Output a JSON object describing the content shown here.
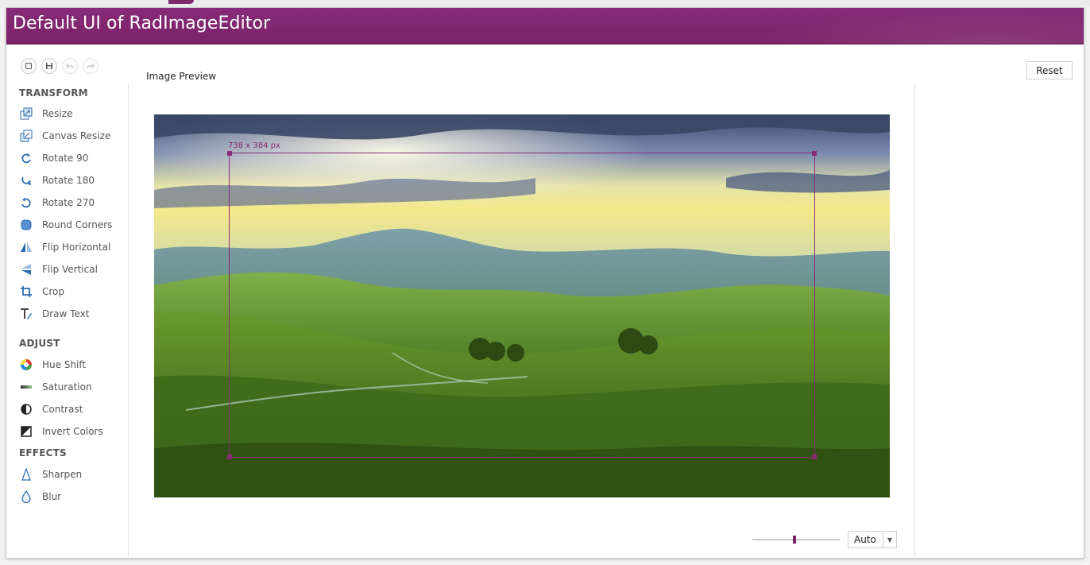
{
  "app": {
    "title": "Default UI of RadImageEditor"
  },
  "toolbar": {
    "buttons": [
      {
        "icon": "open-icon"
      },
      {
        "icon": "save-icon"
      },
      {
        "icon": "undo-icon"
      },
      {
        "icon": "redo-icon"
      }
    ]
  },
  "sidebar": {
    "transform_title": "TRANSFORM",
    "transform": [
      {
        "label": "Resize",
        "icon": "resize-icon"
      },
      {
        "label": "Canvas Resize",
        "icon": "canvas-resize-icon"
      },
      {
        "label": "Rotate 90",
        "icon": "rotate-90-icon"
      },
      {
        "label": "Rotate 180",
        "icon": "rotate-180-icon"
      },
      {
        "label": "Rotate 270",
        "icon": "rotate-270-icon"
      },
      {
        "label": "Round Corners",
        "icon": "round-corners-icon"
      },
      {
        "label": "Flip Horizontal",
        "icon": "flip-horizontal-icon"
      },
      {
        "label": "Flip Vertical",
        "icon": "flip-vertical-icon"
      },
      {
        "label": "Crop",
        "icon": "crop-icon"
      },
      {
        "label": "Draw Text",
        "icon": "draw-text-icon"
      }
    ],
    "adjust_title": "ADJUST",
    "adjust": [
      {
        "label": "Hue Shift",
        "icon": "hue-shift-icon"
      },
      {
        "label": "Saturation",
        "icon": "saturation-icon"
      },
      {
        "label": "Contrast",
        "icon": "contrast-icon"
      },
      {
        "label": "Invert Colors",
        "icon": "invert-colors-icon"
      }
    ],
    "effects_title": "EFFECTS",
    "effects": [
      {
        "label": "Sharpen",
        "icon": "sharpen-icon"
      },
      {
        "label": "Blur",
        "icon": "blur-icon"
      }
    ]
  },
  "main": {
    "preview_label": "Image Preview",
    "reset_label": "Reset",
    "crop_size_label": "738 x 384 px"
  },
  "zoom": {
    "value": "Auto",
    "slider_level": 0.5
  },
  "colors": {
    "accent": "#7b2268",
    "icon_blue": "#2b6cb0"
  }
}
